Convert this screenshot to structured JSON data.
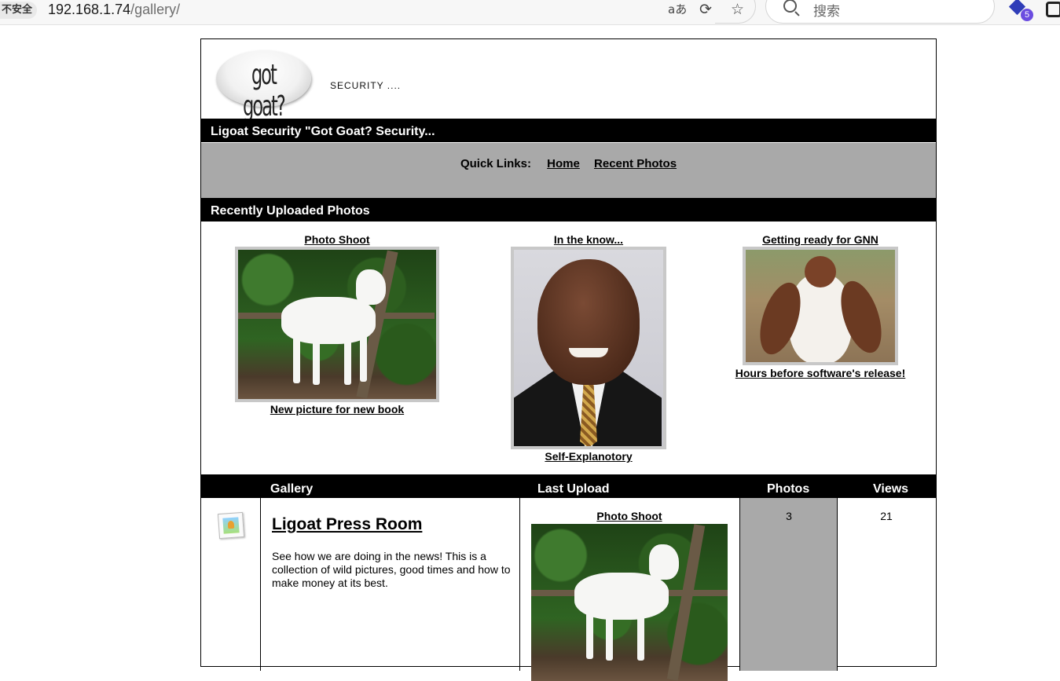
{
  "browser": {
    "security_label": "不安全",
    "url_host": "192.168.1.74",
    "url_path": "/gallery/",
    "read_aloud_icon": "aあ",
    "search_placeholder": "搜索",
    "extension_badge": "5"
  },
  "site": {
    "logo_text": "got goat?",
    "tagline": "SECURITY ....",
    "header_bar": "Ligoat Security \"Got Goat? Security...",
    "quick_links": {
      "label": "Quick Links:",
      "items": [
        "Home",
        "Recent Photos"
      ]
    },
    "recent_header": "Recently Uploaded Photos",
    "recent_photos": [
      {
        "title": "Photo Shoot",
        "caption": "New picture for new book"
      },
      {
        "title": "In the know...",
        "caption": "Self-Explanotory"
      },
      {
        "title": "Getting ready for GNN",
        "caption": "Hours before software's release!"
      }
    ],
    "gallery_table": {
      "headers": {
        "gallery": "Gallery",
        "last_upload": "Last Upload",
        "photos": "Photos",
        "views": "Views"
      },
      "rows": [
        {
          "title": "Ligoat Press Room",
          "description": "See how we are doing in the news! This is a collection of wild pictures, good times and how to make money at its best.",
          "last_upload_title": "Photo Shoot",
          "photos": "3",
          "views": "21"
        }
      ]
    }
  },
  "colors": {
    "bar": "#000000",
    "quick_links_bg": "#a9a9a9",
    "frame": "#c8c8c8"
  }
}
